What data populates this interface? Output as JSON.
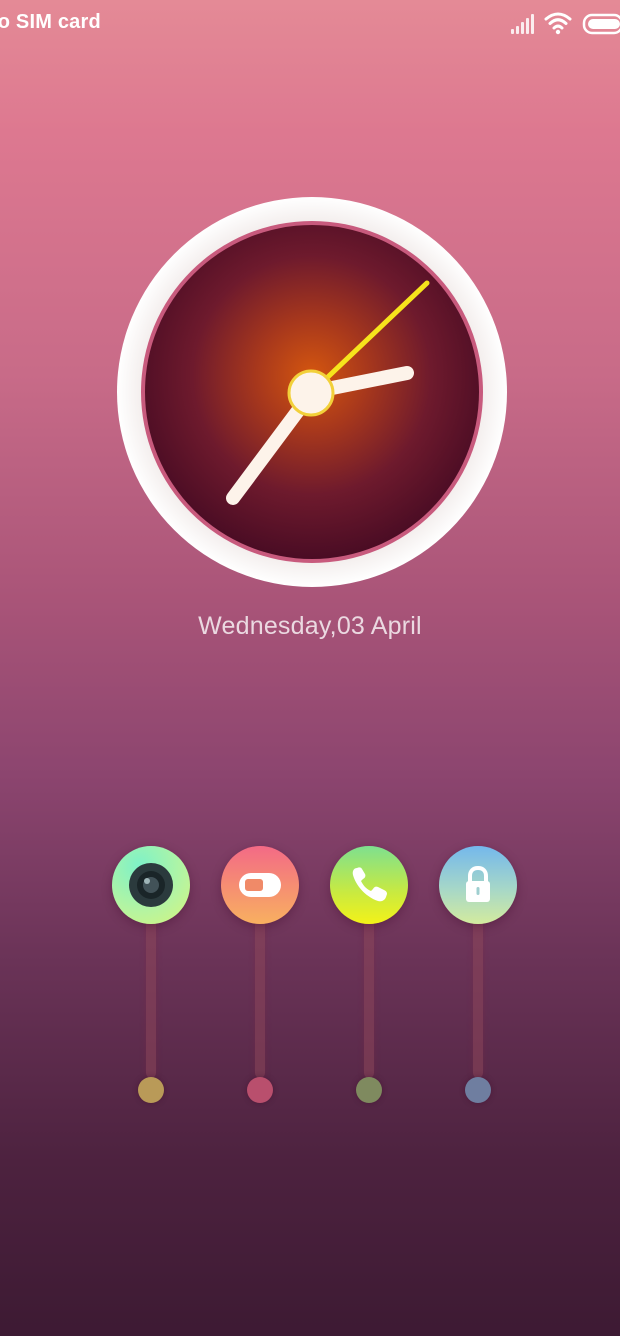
{
  "status_bar": {
    "carrier": "lo SIM card",
    "icons": [
      "signal-icon",
      "wifi-icon",
      "battery-icon"
    ]
  },
  "clock": {
    "type": "analog",
    "face_colors": [
      "#e0601a",
      "#5a1030"
    ],
    "hand_color": "#fdf3ea",
    "second_hand_color": "#f5e020"
  },
  "date": "Wednesday,03 April",
  "shortcuts": [
    {
      "name": "camera",
      "icon": "camera-icon",
      "color_top": "#7ef2c8",
      "color_bottom": "#d7f57a",
      "dot_color": "#b99a58"
    },
    {
      "name": "toggle",
      "icon": "toggle-icon",
      "color_top": "#f36a86",
      "color_bottom": "#f8b060",
      "dot_color": "#b94f6d"
    },
    {
      "name": "phone",
      "icon": "phone-icon",
      "color_top": "#7ee08f",
      "color_bottom": "#f3f218",
      "dot_color": "#7f8a5f"
    },
    {
      "name": "lock",
      "icon": "lock-icon",
      "color_top": "#74b8ec",
      "color_bottom": "#d3eb9e",
      "dot_color": "#6f7ea0"
    }
  ]
}
